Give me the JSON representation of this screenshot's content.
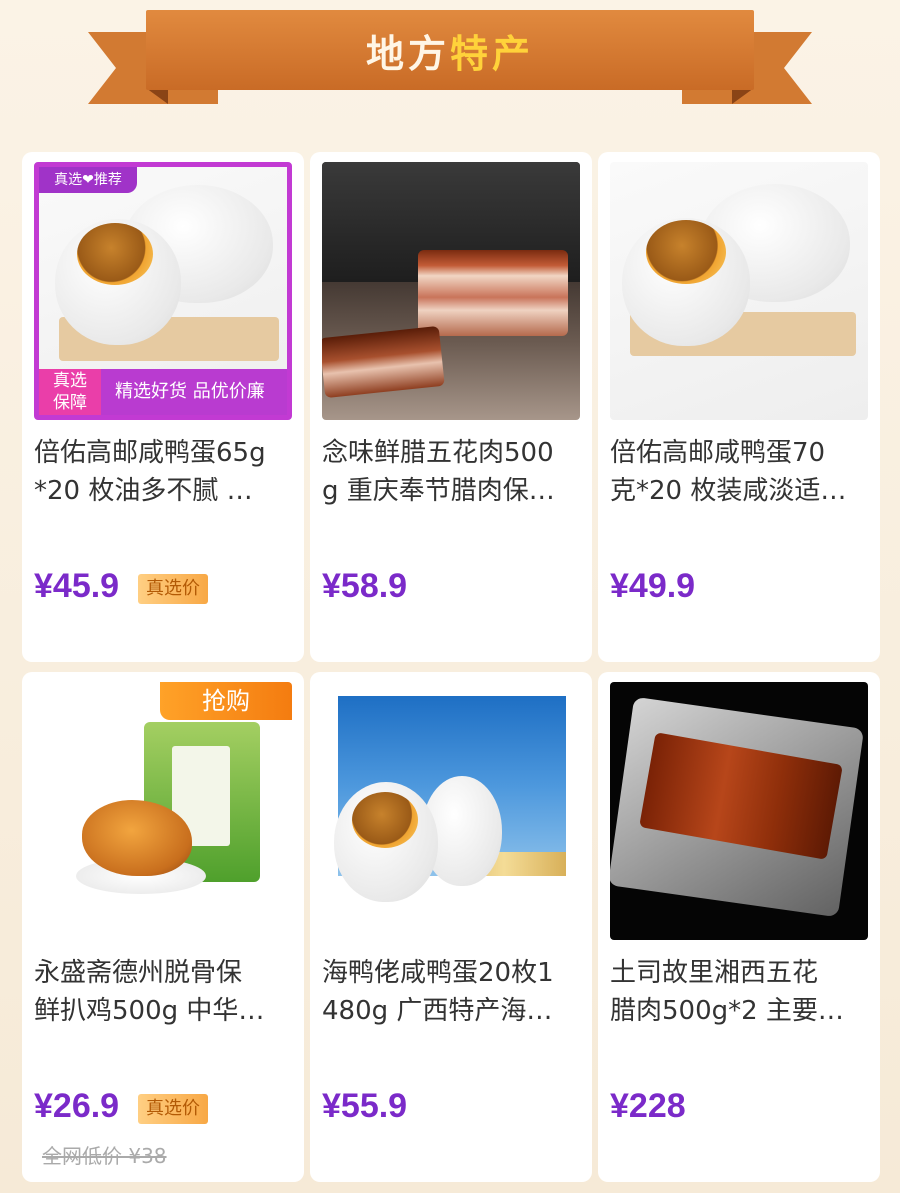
{
  "header": {
    "title_part1": "地方",
    "title_part2": "特产"
  },
  "products": [
    {
      "name_line1": "倍佑高邮咸鸭蛋65g",
      "name_line2": "*20 枚油多不腻 …",
      "price": "¥45.9",
      "tag": "真选价",
      "image_badges": {
        "top": "真选❤推荐",
        "bottom_left": "真选\n保障",
        "bottom_text": "精选好货 品优价廉"
      }
    },
    {
      "name_line1": "念味鲜腊五花肉500",
      "name_line2": "g 重庆奉节腊肉保…",
      "price": "¥58.9"
    },
    {
      "name_line1": "倍佑高邮咸鸭蛋70",
      "name_line2": "克*20 枚装咸淡适…",
      "price": "¥49.9"
    },
    {
      "name_line1": "永盛斋德州脱骨保",
      "name_line2": "鲜扒鸡500g 中华…",
      "price": "¥26.9",
      "tag": "真选价",
      "original_price": "全网低价 ¥38",
      "image_badge": "抢购"
    },
    {
      "name_line1": "海鸭佬咸鸭蛋20枚1",
      "name_line2": "480g 广西特产海…",
      "price": "¥55.9"
    },
    {
      "name_line1": "土司故里湘西五花",
      "name_line2": "腊肉500g*2 主要…",
      "price": "¥228"
    }
  ],
  "colors": {
    "price": "#7b2ac9",
    "banner": "#d27a32",
    "banner_accent": "#ffd23a",
    "tag": "#f8a845"
  }
}
